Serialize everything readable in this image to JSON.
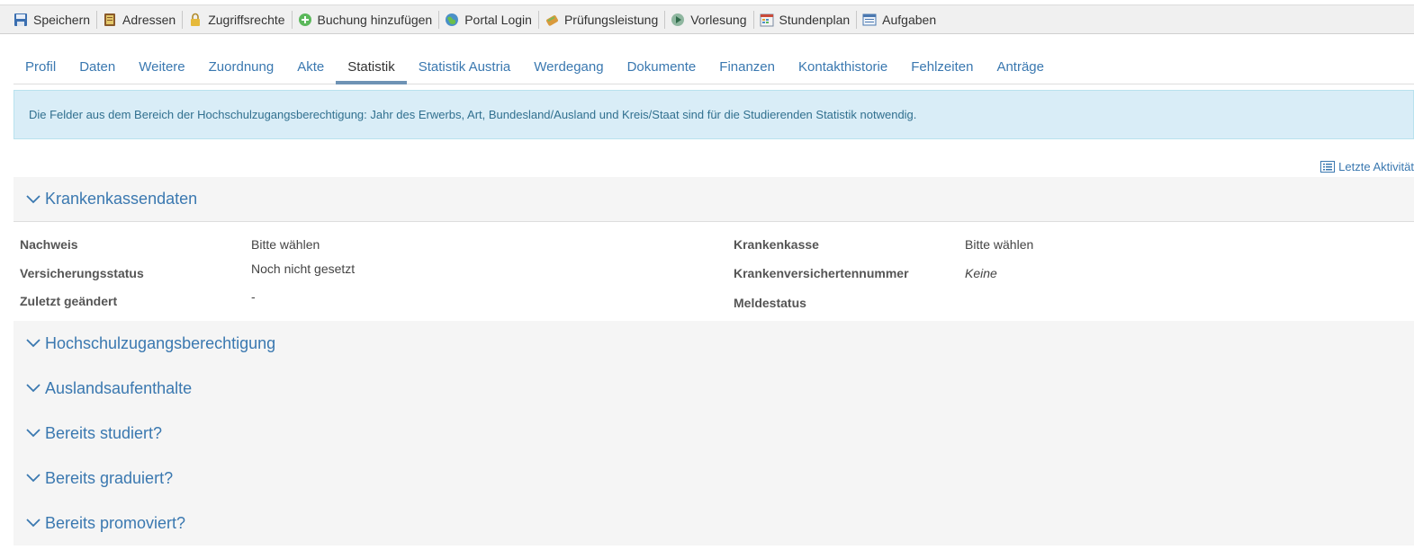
{
  "toolbar": {
    "items": [
      {
        "label": "Speichern",
        "icon": "save-icon"
      },
      {
        "label": "Adressen",
        "icon": "address-book-icon"
      },
      {
        "label": "Zugriffsrechte",
        "icon": "lock-icon"
      },
      {
        "label": "Buchung hinzufügen",
        "icon": "add-circle-icon"
      },
      {
        "label": "Portal Login",
        "icon": "globe-icon"
      },
      {
        "label": "Prüfungsleistung",
        "icon": "exam-icon"
      },
      {
        "label": "Vorlesung",
        "icon": "lecture-icon"
      },
      {
        "label": "Stundenplan",
        "icon": "calendar-icon"
      },
      {
        "label": "Aufgaben",
        "icon": "tasks-icon"
      }
    ]
  },
  "tabs": [
    {
      "label": "Profil"
    },
    {
      "label": "Daten"
    },
    {
      "label": "Weitere"
    },
    {
      "label": "Zuordnung"
    },
    {
      "label": "Akte"
    },
    {
      "label": "Statistik",
      "active": true
    },
    {
      "label": "Statistik Austria"
    },
    {
      "label": "Werdegang"
    },
    {
      "label": "Dokumente"
    },
    {
      "label": "Finanzen"
    },
    {
      "label": "Kontakthistorie"
    },
    {
      "label": "Fehlzeiten"
    },
    {
      "label": "Anträge"
    }
  ],
  "info_text": "Die Felder aus dem Bereich der Hochschulzugangsberechtigung: Jahr des Erwerbs, Art, Bundesland/Ausland und Kreis/Staat sind für die Studierenden Statistik notwendig.",
  "last_activity": "Letzte Aktivität",
  "sections": {
    "krankenkasse": {
      "title": "Krankenkassendaten",
      "fields": {
        "nachweis_label": "Nachweis",
        "nachweis_value": "Bitte wählen",
        "versicherungsstatus_label": "Versicherungsstatus",
        "versicherungsstatus_value": "Noch nicht gesetzt",
        "zuletzt_label": "Zuletzt geändert",
        "zuletzt_value": "-",
        "krankenkasse_label": "Krankenkasse",
        "krankenkasse_value": "Bitte wählen",
        "kvnr_label": "Krankenversichertennummer",
        "kvnr_value": "Keine",
        "meldestatus_label": "Meldestatus"
      }
    },
    "hzb": {
      "title": "Hochschulzugangsberechtigung"
    },
    "ausland": {
      "title": "Auslandsaufenthalte"
    },
    "studiert": {
      "title": "Bereits studiert?"
    },
    "graduiert": {
      "title": "Bereits graduiert?"
    },
    "promoviert": {
      "title": "Bereits promoviert?"
    }
  },
  "colors": {
    "link": "#3a78b0",
    "info_bg": "#d9edf7",
    "info_text": "#31708f",
    "tab_indicator": "#6e93b5"
  }
}
